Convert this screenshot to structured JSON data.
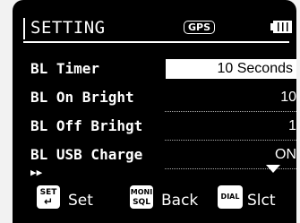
{
  "header": {
    "title": "SETTING",
    "gps_label": "GPS",
    "battery_icon": "battery-full-icon"
  },
  "settings": [
    {
      "label": "BL Timer",
      "value": "10 Seconds",
      "selected": true
    },
    {
      "label": "BL On Bright",
      "value": "10",
      "selected": false
    },
    {
      "label": "BL Off Brihgt",
      "value": "1",
      "selected": false
    },
    {
      "label": "BL USB Charge",
      "value": "ON",
      "selected": false
    }
  ],
  "more_indicator": "▶▶",
  "footer": {
    "set_key": {
      "line1": "SET",
      "line2": "↵",
      "label": "Set"
    },
    "moni_key": {
      "line1": "MONI",
      "line2": "SQL",
      "label": "Back"
    },
    "dial_key": {
      "line1": "DIAL",
      "label": "Slct"
    }
  }
}
